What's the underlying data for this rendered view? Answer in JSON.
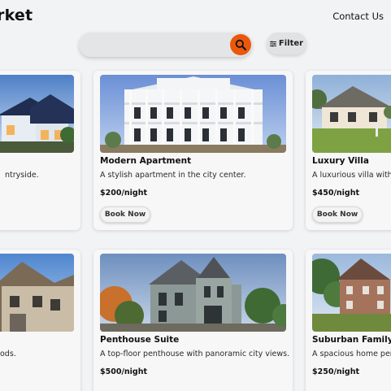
{
  "header": {
    "logo_text": "rket",
    "contact_label": "Contact Us"
  },
  "search": {
    "placeholder": "",
    "value": ""
  },
  "filter": {
    "label": "Filter"
  },
  "accent_color": "#ea580c",
  "listings": [
    {
      "title": "",
      "description": "ntryside.",
      "price": "",
      "button": ""
    },
    {
      "title": "Modern Apartment",
      "description": "A stylish apartment in the city center.",
      "price": "$200/night",
      "button": "Book Now"
    },
    {
      "title": "Luxury Villa",
      "description": "A luxurious villa with s",
      "price": "$450/night",
      "button": "Book Now"
    },
    {
      "title": "",
      "description": "ods.",
      "price": "",
      "button": ""
    },
    {
      "title": "Penthouse Suite",
      "description": "A top-floor penthouse with panoramic city views.",
      "price": "$500/night",
      "button": ""
    },
    {
      "title": "Suburban Family H",
      "description": "A spacious home perf",
      "price": "$250/night",
      "button": ""
    }
  ]
}
